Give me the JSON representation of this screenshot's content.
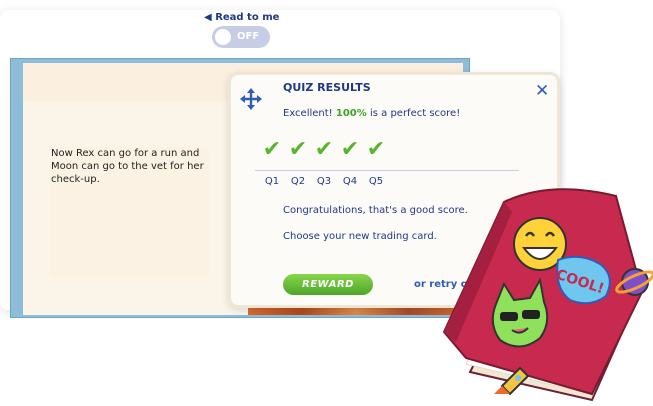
{
  "audio": {
    "read_label": "Read to me",
    "toggle_label": "OFF"
  },
  "story": {
    "text": "Now Rex can go for a run and Moon can go to the vet for her check-up."
  },
  "quiz": {
    "title": "QUIZ RESULTS",
    "score_prefix": "Excellent!",
    "score_value": "100%",
    "score_suffix": "is a perfect score!",
    "questions": [
      "Q1",
      "Q2",
      "Q3",
      "Q4",
      "Q5"
    ],
    "check_glyph": "✔",
    "close_glyph": "✕",
    "congrats": "Congratulations, that's a good score.",
    "choose": "Choose your new trading card.",
    "reward_label": "REWARD",
    "retry_label": "or retry quiz"
  },
  "sticker_book": {
    "badge_text": "COOL!"
  },
  "colors": {
    "accent_blue": "#1d3a86",
    "success_green": "#59b52d",
    "book_red": "#c8294f"
  },
  "icons": [
    "speaker-icon",
    "move-icon",
    "close-icon",
    "check-icon",
    "laughing-emoji-icon",
    "cat-sunglasses-icon",
    "planet-icon",
    "rocket-icon"
  ]
}
